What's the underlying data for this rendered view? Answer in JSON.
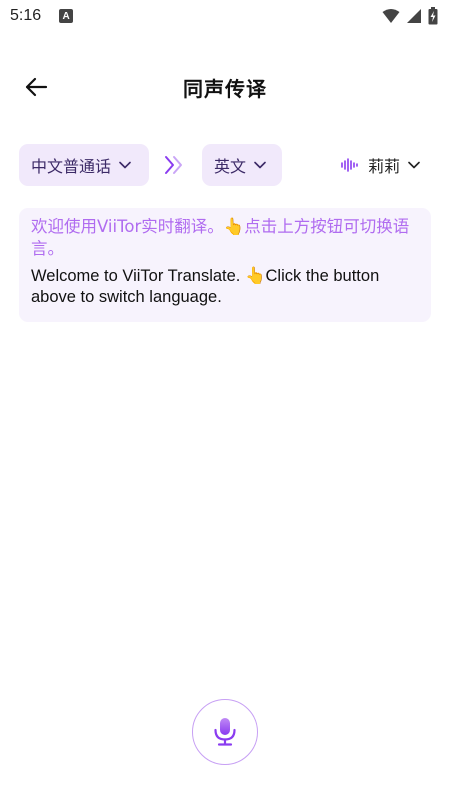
{
  "statusbar": {
    "time": "5:16",
    "notification": "A"
  },
  "header": {
    "title": "同声传译"
  },
  "language_bar": {
    "source_language": "中文普通话",
    "target_language": "英文",
    "voice": "莉莉"
  },
  "message": {
    "source_text": "欢迎使用ViiTor实时翻译。👆点击上方按钮可切换语言。",
    "translated_text": "Welcome to ViiTor Translate. 👆Click the button above to switch language."
  },
  "colors": {
    "accent": "#8a3cf0",
    "chip_bg": "#f1e9fb",
    "source_text": "#b06cf0",
    "card_bg": "#f7f3fd"
  },
  "icons": {
    "back": "arrow-left-icon",
    "swap": "double-chevron-right-icon",
    "voice": "soundwave-icon",
    "mic": "microphone-icon"
  }
}
